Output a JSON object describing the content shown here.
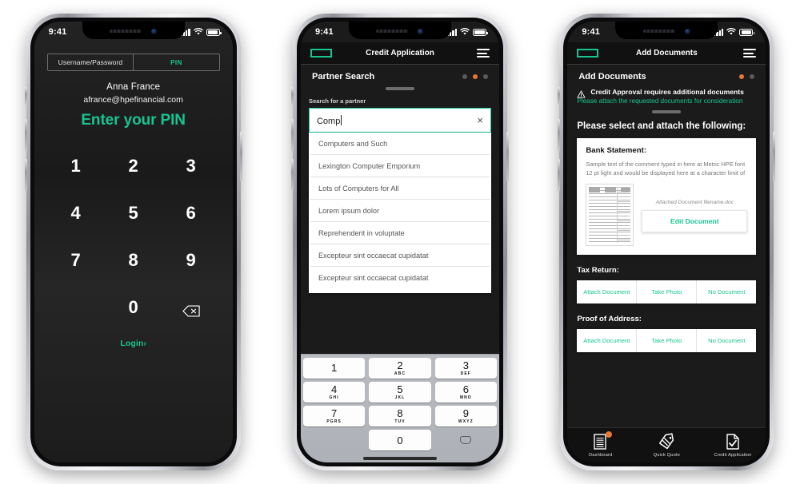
{
  "screens": [
    {
      "id": "pin-login",
      "statusbar": {
        "time": "9:41"
      },
      "tabs": [
        {
          "label": "Username/Password",
          "active": false
        },
        {
          "label": "PIN",
          "active": true
        }
      ],
      "account": {
        "name": "Anna France",
        "email": "afrance@hpefinancial.com"
      },
      "heading": "Enter your PIN",
      "keypad": [
        "1",
        "2",
        "3",
        "4",
        "5",
        "6",
        "7",
        "8",
        "9",
        "",
        "0",
        "backspace"
      ],
      "login_link": "Login",
      "login_chevron": "›",
      "colors": {
        "accent": "#18c48f",
        "background": "#1d1d1d"
      }
    },
    {
      "id": "credit-application",
      "statusbar": {
        "time": "9:41"
      },
      "appbar": {
        "title": "Credit Application",
        "logo": "hpe-logo",
        "menu": "hamburger-menu-icon"
      },
      "section": {
        "title": "Partner Search",
        "dots": [
          false,
          true,
          false
        ]
      },
      "search": {
        "label": "Search for a partner",
        "value": "Comp",
        "clear_icon": "×"
      },
      "results": [
        "Computers and Such",
        "Lexington Computer Emporium",
        "Lots of Computers for All",
        "Lorem ipsum dolor",
        "Reprehenderit in voluptate",
        "Excepteur sint occaecat cupidatat",
        "Excepteur sint occaecat cupidatat"
      ],
      "keyboard": [
        {
          "num": "1",
          "sub": ""
        },
        {
          "num": "2",
          "sub": "ABC"
        },
        {
          "num": "3",
          "sub": "DEF"
        },
        {
          "num": "4",
          "sub": "GHI"
        },
        {
          "num": "5",
          "sub": "JKL"
        },
        {
          "num": "6",
          "sub": "MNO"
        },
        {
          "num": "7",
          "sub": "PGRS"
        },
        {
          "num": "8",
          "sub": "TUV"
        },
        {
          "num": "9",
          "sub": "WXYZ"
        },
        {
          "num": "0",
          "sub": ""
        }
      ],
      "colors": {
        "accent": "#18c48f",
        "page_dot": "#e8763a"
      }
    },
    {
      "id": "add-documents",
      "statusbar": {
        "time": "9:41"
      },
      "appbar": {
        "title": "Add Documents",
        "logo": "hpe-logo",
        "menu": "hamburger-menu-icon"
      },
      "section": {
        "title": "Add Documents",
        "dots": [
          true,
          false
        ]
      },
      "alert": {
        "main": "Credit Approval requires additional documents",
        "sub": "Please attach the requested documents for consideration",
        "icon": "warning-triangle-icon"
      },
      "ask_title": "Please select and attach the following:",
      "bank_statement": {
        "title": "Bank Statement:",
        "description": "Sample text of the comment typed in here at Metric HPE font 12 pt light and would be displayed here at a character limit of",
        "attached_label": "Attached Document filename.doc",
        "edit_label": "Edit Document"
      },
      "doc_sections": [
        {
          "title": "Tax Return:",
          "buttons": [
            "Attach Document",
            "Take Photo",
            "No Document"
          ]
        },
        {
          "title": "Proof of Address:",
          "buttons": [
            "Attach Document",
            "Take Photo",
            "No Document"
          ]
        }
      ],
      "tabbar": [
        {
          "label": "Dashboard",
          "icon": "dashboard-list-icon",
          "badge": true
        },
        {
          "label": "Quick Quote",
          "icon": "price-tag-icon",
          "badge": false
        },
        {
          "label": "Credit Application",
          "icon": "document-check-icon",
          "badge": false
        }
      ],
      "colors": {
        "accent": "#18c48f",
        "warning": "#e8763a"
      }
    }
  ]
}
